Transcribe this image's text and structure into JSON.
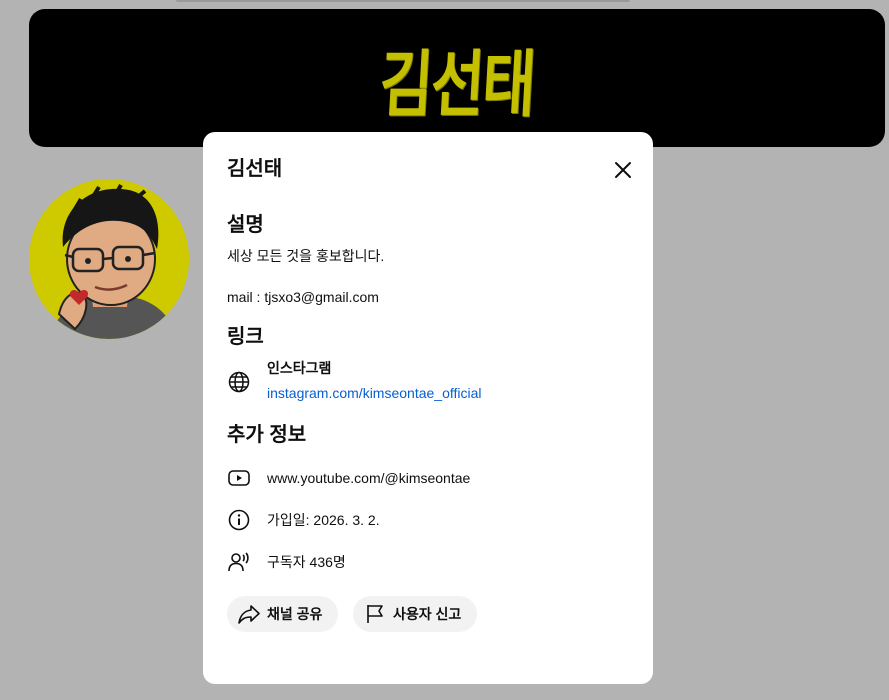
{
  "banner": {
    "logo_text": "김선태",
    "logo_color": "#c4c000"
  },
  "dialog": {
    "title": "김선태",
    "close_icon": "close-icon",
    "description": {
      "heading": "설명",
      "line1": "세상 모든 것을 홍보합니다.",
      "line2": "mail : tjsxo3@gmail.com"
    },
    "links": {
      "heading": "링크",
      "items": [
        {
          "icon": "globe-icon",
          "title": "인스타그램",
          "url": "instagram.com/kimseontae_official"
        }
      ]
    },
    "more_info": {
      "heading": "추가 정보",
      "channel_url": "www.youtube.com/@kimseontae",
      "joined": "가입일: 2026. 3. 2.",
      "subscribers": "구독자 436명"
    },
    "actions": {
      "share_label": "채널 공유",
      "report_label": "사용자 신고"
    }
  },
  "colors": {
    "overlay": "#b3b3b3",
    "link": "#065fd4",
    "pill_bg": "#f2f2f2"
  }
}
